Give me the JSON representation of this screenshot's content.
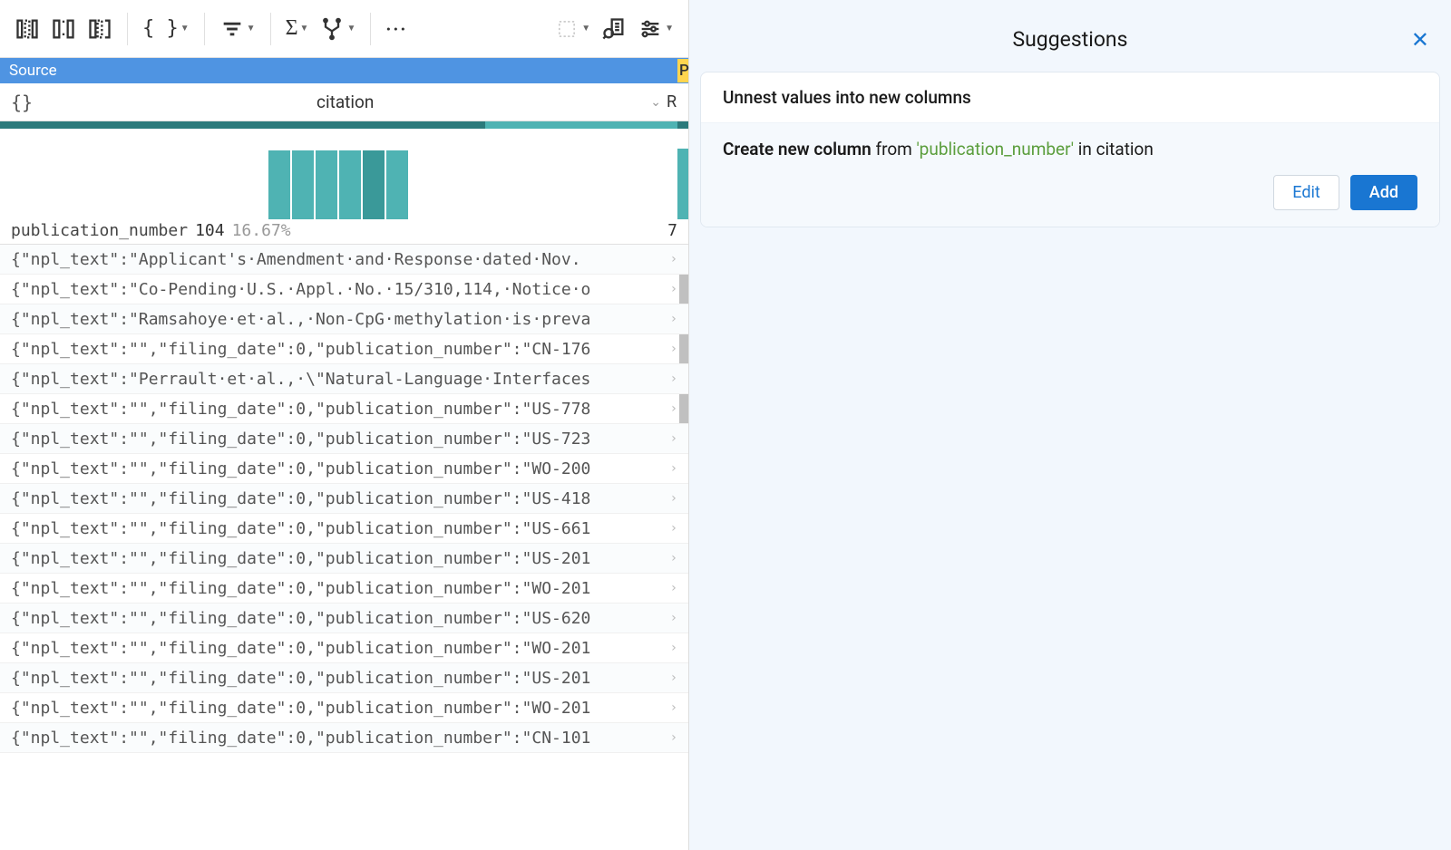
{
  "toolbar": {},
  "column_header": {
    "source_label": "Source",
    "p_label": "P"
  },
  "column_title": {
    "braces": "{}",
    "title": "citation",
    "right_char": "R"
  },
  "stats": {
    "label": "publication_number",
    "count": "104",
    "pct": "16.67%",
    "right_char": "7"
  },
  "rows": [
    "{\"npl_text\":\"Applicant's·Amendment·and·Response·dated·Nov.",
    "{\"npl_text\":\"Co-Pending·U.S.·Appl.·No.·15/310,114,·Notice·o",
    "{\"npl_text\":\"Ramsahoye·et·al.,·Non-CpG·methylation·is·preva",
    "{\"npl_text\":\"\",\"filing_date\":0,\"publication_number\":\"CN-176",
    "{\"npl_text\":\"Perrault·et·al.,·\\\"Natural-Language·Interfaces",
    "{\"npl_text\":\"\",\"filing_date\":0,\"publication_number\":\"US-778",
    "{\"npl_text\":\"\",\"filing_date\":0,\"publication_number\":\"US-723",
    "{\"npl_text\":\"\",\"filing_date\":0,\"publication_number\":\"WO-200",
    "{\"npl_text\":\"\",\"filing_date\":0,\"publication_number\":\"US-418",
    "{\"npl_text\":\"\",\"filing_date\":0,\"publication_number\":\"US-661",
    "{\"npl_text\":\"\",\"filing_date\":0,\"publication_number\":\"US-201",
    "{\"npl_text\":\"\",\"filing_date\":0,\"publication_number\":\"WO-201",
    "{\"npl_text\":\"\",\"filing_date\":0,\"publication_number\":\"US-620",
    "{\"npl_text\":\"\",\"filing_date\":0,\"publication_number\":\"WO-201",
    "{\"npl_text\":\"\",\"filing_date\":0,\"publication_number\":\"US-201",
    "{\"npl_text\":\"\",\"filing_date\":0,\"publication_number\":\"WO-201",
    "{\"npl_text\":\"\",\"filing_date\":0,\"publication_number\":\"CN-101"
  ],
  "suggestions": {
    "title": "Suggestions",
    "card_header": "Unnest values into new columns",
    "card_text_prefix": "Create new column",
    "card_text_from": " from ",
    "card_text_highlight": "'publication_number'",
    "card_text_suffix": " in citation",
    "edit_label": "Edit",
    "add_label": "Add"
  }
}
